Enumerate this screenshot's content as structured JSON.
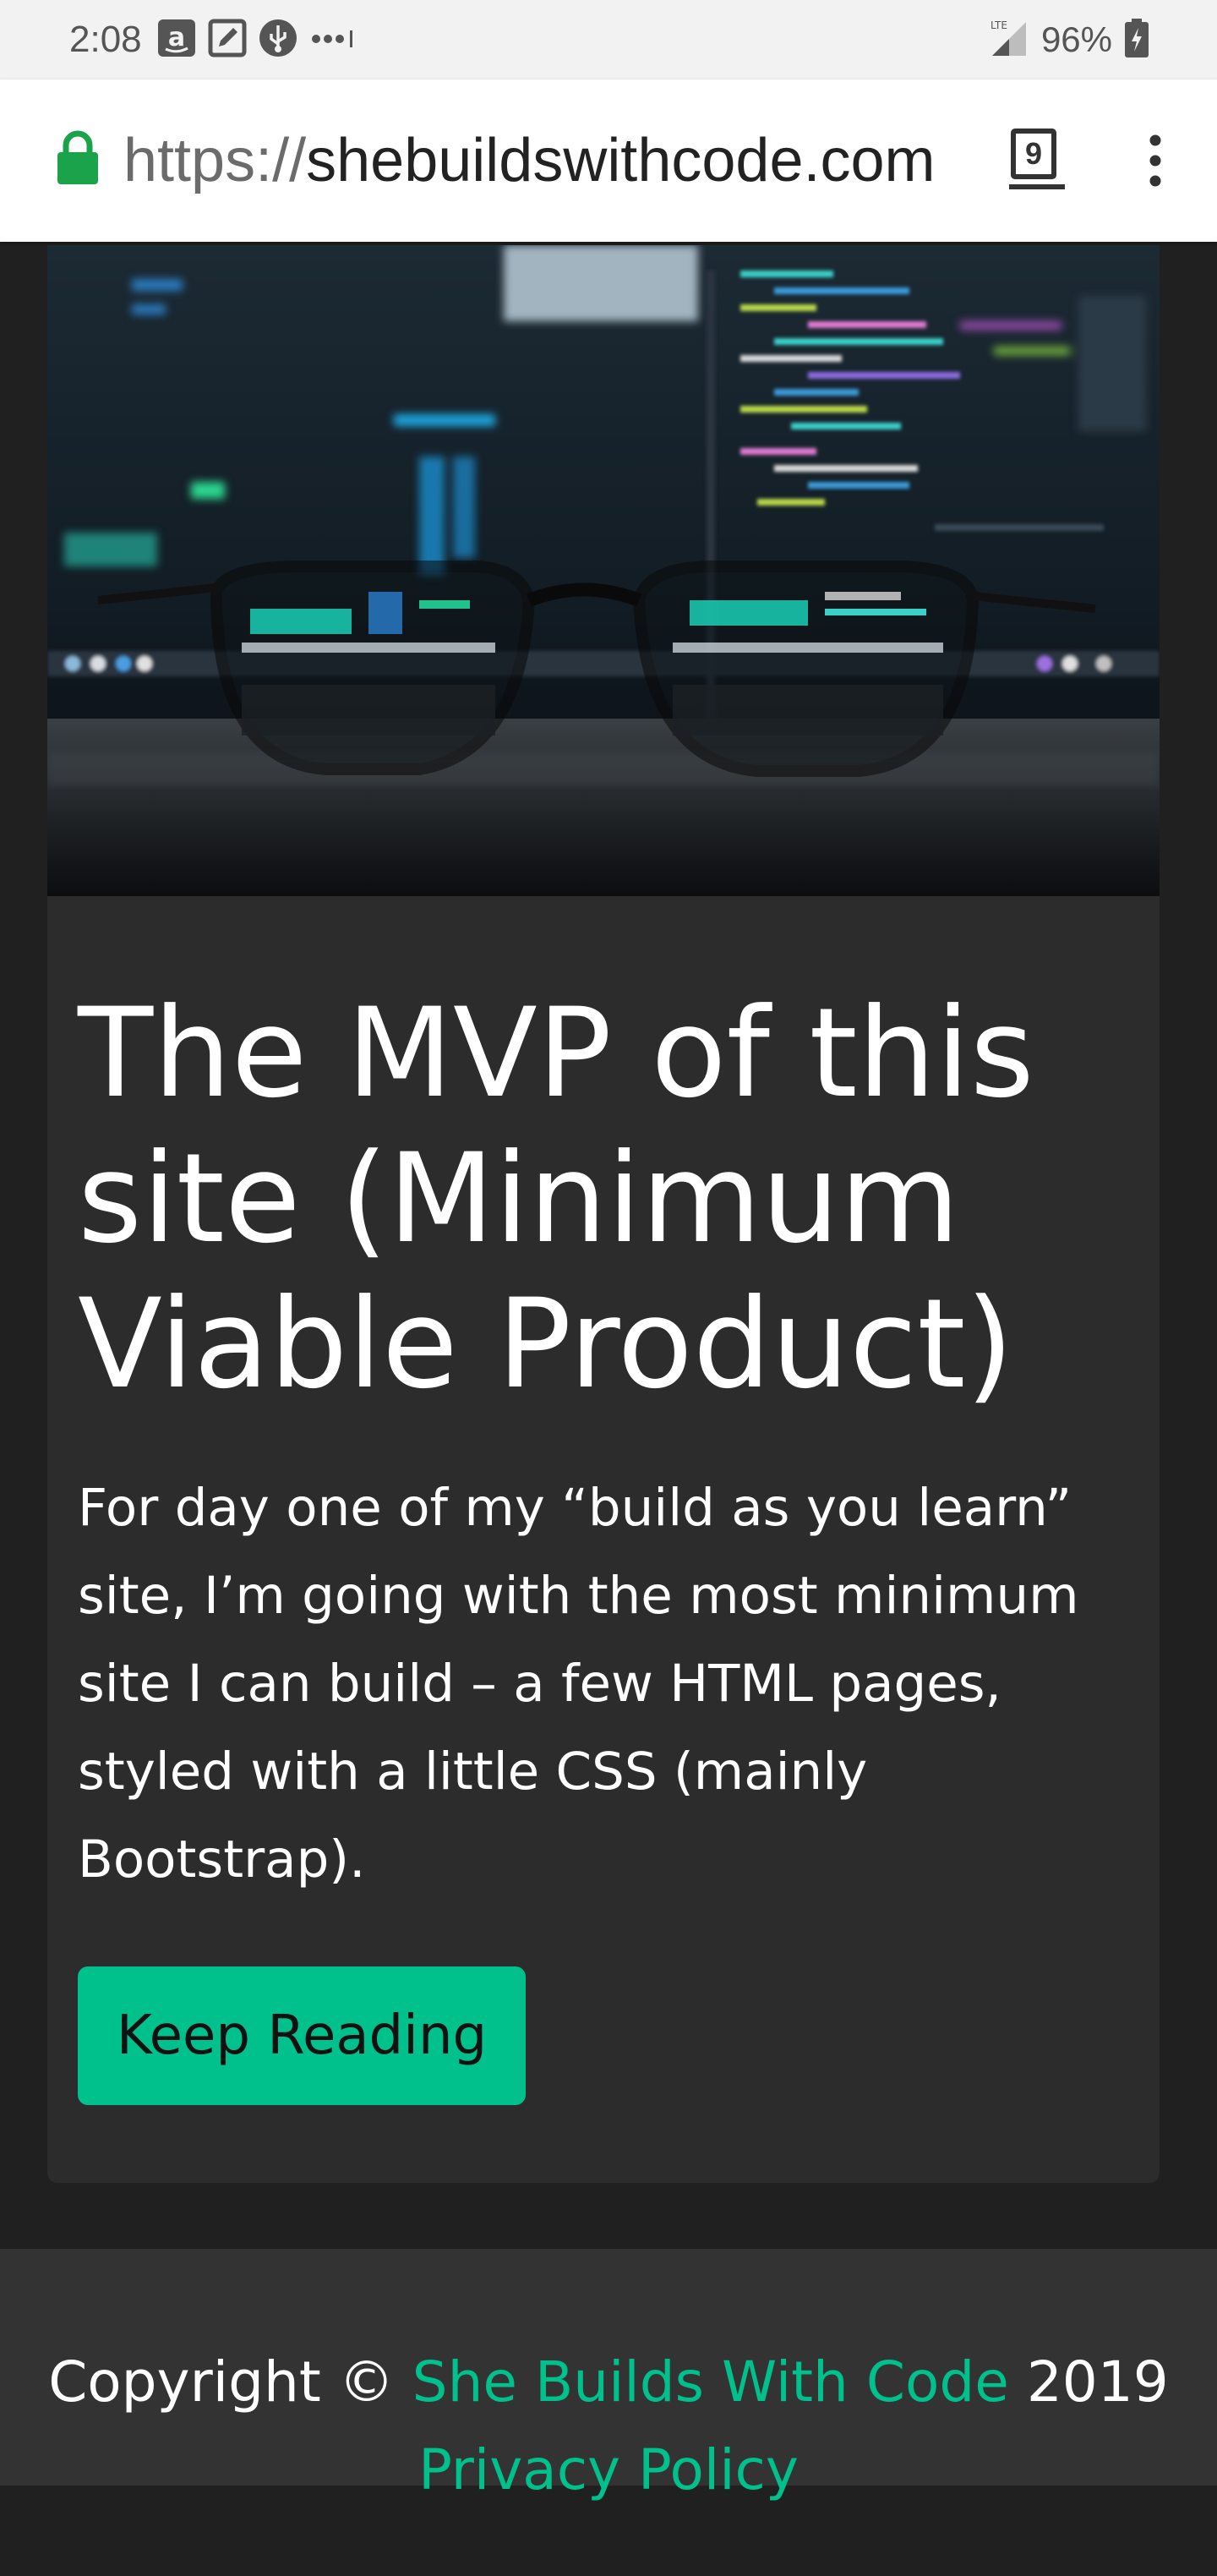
{
  "status_bar": {
    "time": "2:08",
    "network": "LTE",
    "battery": "96%",
    "left_icons": [
      "amazon-icon",
      "edit-icon",
      "usb-icon",
      "more-dots-icon"
    ],
    "right_icons": [
      "signal-icon",
      "battery-icon"
    ]
  },
  "browser": {
    "url_scheme": "https://",
    "url_host": "shebuildswithcode.com",
    "tab_count": "9",
    "secure_color": "#1aa34a"
  },
  "post": {
    "title": "The MVP of this site (Minimum Viable Product)",
    "excerpt": "For day one of my “build as you learn” site, I’m going with the most minimum site I can build – a few HTML pages, styled with a little CSS (mainly Bootstrap).",
    "button_label": "Keep Reading",
    "hero_icon": "glasses-on-keyboard-photo"
  },
  "footer": {
    "copyright_prefix": "Copyright ©",
    "site_name": "She Builds With Code",
    "year": "2019",
    "privacy_label": "Privacy Policy"
  },
  "colors": {
    "accent": "#00c08b",
    "page_bg": "#202020",
    "card_bg": "#2c2c2c",
    "footer_bg": "#333333"
  }
}
